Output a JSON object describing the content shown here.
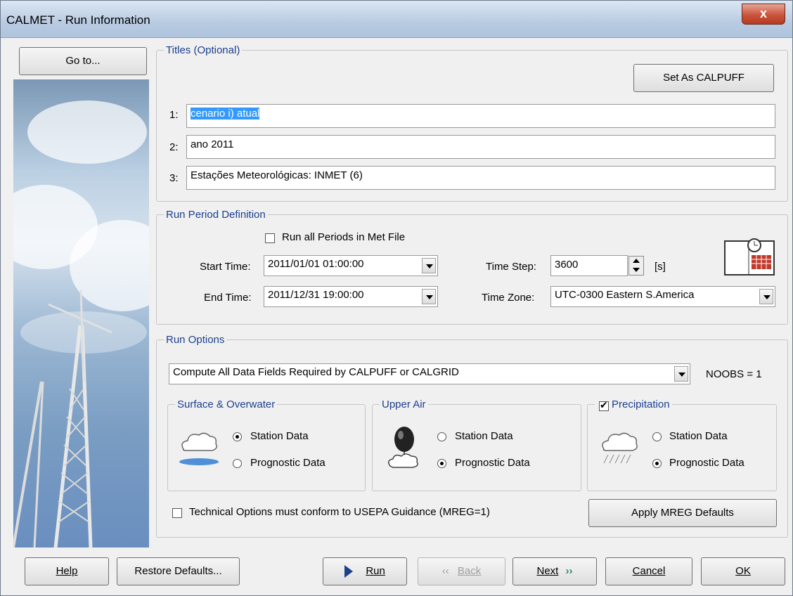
{
  "window": {
    "title": "CALMET - Run Information",
    "close_label": "x"
  },
  "sidebar": {
    "goto_label": "Go to..."
  },
  "titles": {
    "legend": "Titles (Optional)",
    "set_as_calpuff": "Set As CALPUFF",
    "lines": [
      {
        "label": "1:",
        "value": "cenario i) atual"
      },
      {
        "label": "2:",
        "value": "ano 2011"
      },
      {
        "label": "3:",
        "value": "Estações Meteorológicas: INMET (6)"
      }
    ]
  },
  "run_period": {
    "legend": "Run Period Definition",
    "run_all_label": "Run all Periods in Met File",
    "start_label": "Start Time:",
    "start_value": "2011/01/01 01:00:00",
    "end_label": "End Time:",
    "end_value": "2011/12/31 19:00:00",
    "timestep_label": "Time Step:",
    "timestep_value": "3600",
    "timestep_unit": "[s]",
    "timezone_label": "Time Zone:",
    "timezone_value": "UTC-0300 Eastern S.America"
  },
  "run_options": {
    "legend": "Run Options",
    "compute_value": "Compute All Data Fields Required by CALPUFF or CALGRID",
    "noobs": "NOOBS = 1",
    "surface": {
      "legend": "Surface & Overwater",
      "opt1": "Station Data",
      "opt2": "Prognostic Data"
    },
    "upper": {
      "legend": "Upper Air",
      "opt1": "Station Data",
      "opt2": "Prognostic Data"
    },
    "precip": {
      "legend": "Precipitation",
      "opt1": "Station Data",
      "opt2": "Prognostic Data"
    },
    "technical_label": "Technical Options must conform to USEPA Guidance (MREG=1)",
    "apply_mreg": "Apply MREG Defaults"
  },
  "footer": {
    "help": "Help",
    "restore": "Restore Defaults...",
    "run": "Run",
    "back": "Back",
    "next": "Next",
    "cancel": "Cancel",
    "ok": "OK"
  }
}
